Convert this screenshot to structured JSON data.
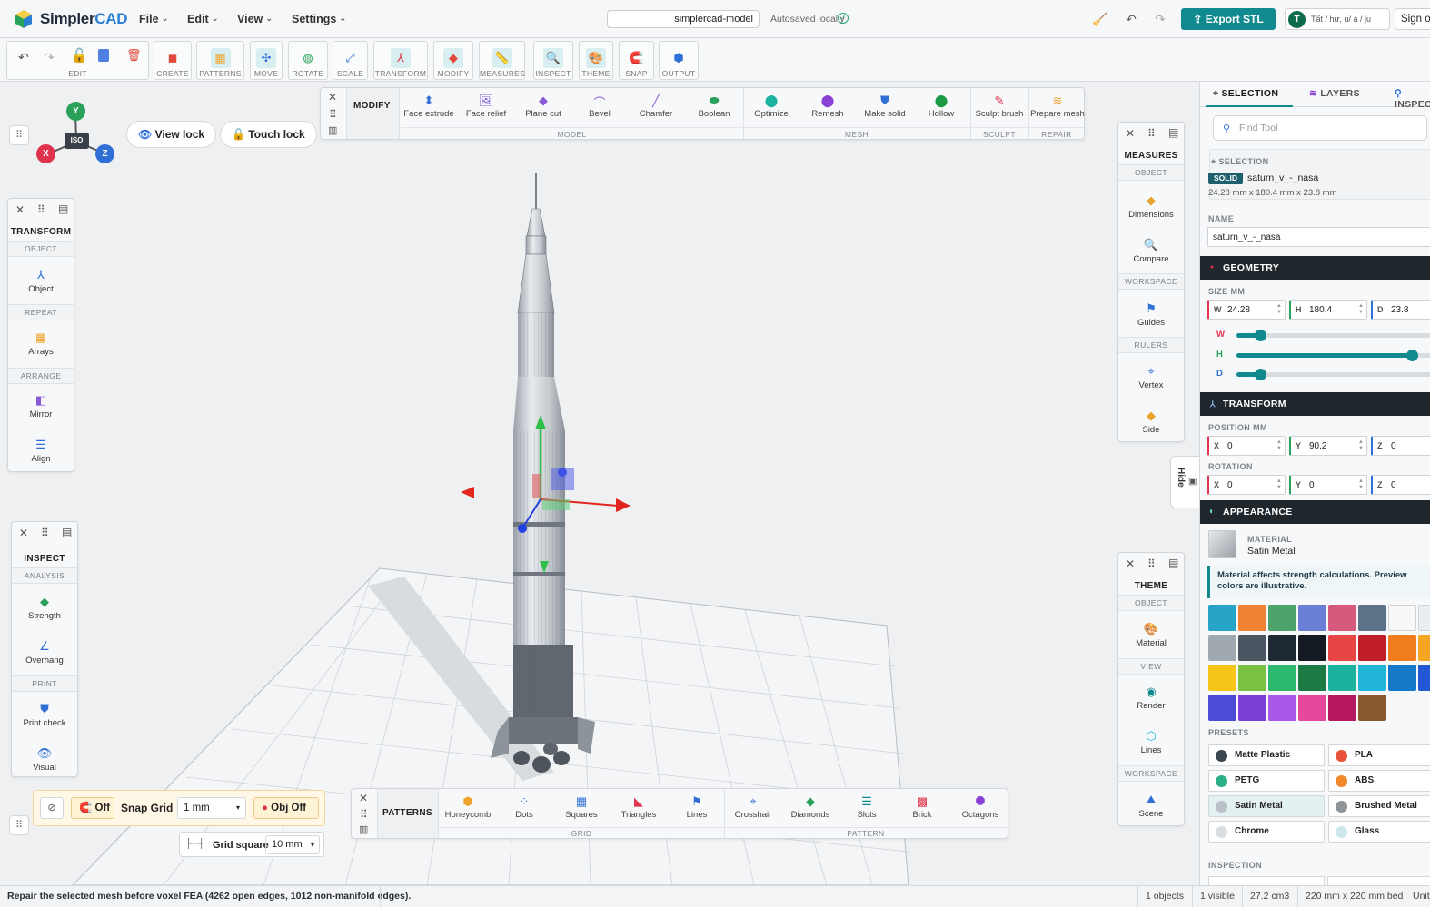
{
  "app": {
    "brand_a": "Simpler",
    "brand_b": "CAD"
  },
  "menu": {
    "file": "File",
    "edit": "Edit",
    "view": "View",
    "settings": "Settings"
  },
  "topbar": {
    "model_name": "simplercad-model",
    "autosave": "Autosaved locally",
    "export": "Export STL",
    "avatar_letter": "T",
    "user_name": "Tất / hư, u/ á / ju",
    "signin": "Sign out"
  },
  "ribbon": [
    {
      "label": "EDIT"
    },
    {
      "label": "CREATE"
    },
    {
      "label": "PATTERNS"
    },
    {
      "label": "MOVE"
    },
    {
      "label": "ROTATE"
    },
    {
      "label": "SCALE"
    },
    {
      "label": "TRANSFORM"
    },
    {
      "label": "MODIFY"
    },
    {
      "label": "MEASURES"
    },
    {
      "label": "INSPECT"
    },
    {
      "label": "THEME"
    },
    {
      "label": "SNAP"
    },
    {
      "label": "OUTPUT"
    }
  ],
  "view_controls": {
    "iso": "ISO",
    "x": "X",
    "y": "Y",
    "z": "Z",
    "view_lock": "View lock",
    "touch_lock": "Touch lock"
  },
  "modify_bar": {
    "title": "MODIFY",
    "tools": [
      "Face extrude",
      "Face relief",
      "Plane cut",
      "Bevel",
      "Chamfer",
      "Boolean",
      "Optimize",
      "Remesh",
      "Make solid",
      "Hollow",
      "Sculpt brush",
      "Prepare mesh"
    ],
    "sections": [
      "MODEL",
      "MESH",
      "SCULPT",
      "REPAIR"
    ]
  },
  "transform_panel": {
    "title": "TRANSFORM",
    "s1": "OBJECT",
    "t1": "Object",
    "s2": "REPEAT",
    "t2": "Arrays",
    "s3": "ARRANGE",
    "t3": "Mirror",
    "t4": "Align"
  },
  "inspect_panel": {
    "title": "INSPECT",
    "s1": "ANALYSIS",
    "t1": "Strength",
    "t2": "Overhang",
    "s2": "PRINT",
    "t3": "Print check",
    "t4": "Visual"
  },
  "measures_panel": {
    "title": "MEASURES",
    "s1": "OBJECT",
    "t1": "Dimensions",
    "t2": "Compare",
    "s2": "WORKSPACE",
    "t3": "Guides",
    "s3": "RULERS",
    "t4": "Vertex",
    "t5": "Side"
  },
  "theme_panel": {
    "title": "THEME",
    "s1": "OBJECT",
    "t1": "Material",
    "s2": "VIEW",
    "t2": "Render",
    "t3": "Lines",
    "s3": "WORKSPACE",
    "t4": "Scene"
  },
  "hide_tab": "Hide",
  "snap_bar": {
    "snap_state": "Off",
    "snap_grid_label": "Snap Grid",
    "snap_grid_value": "1 mm",
    "obj_snap": "Obj Off",
    "grid_square_label": "Grid square",
    "grid_square_value": "10 mm"
  },
  "patterns_bar": {
    "title": "PATTERNS",
    "tools": [
      "Honeycomb",
      "Dots",
      "Squares",
      "Triangles",
      "Lines",
      "Crosshair",
      "Diamonds",
      "Slots",
      "Brick",
      "Octagons"
    ],
    "sections": [
      "GRID",
      "PATTERN"
    ]
  },
  "sidebar": {
    "tabs": [
      "SELECTION",
      "LAYERS",
      "INSPECT"
    ],
    "search_placeholder": "Find Tool",
    "selection_label": "SELECTION",
    "badge": "SOLID",
    "object_name": "saturn_v_-_nasa",
    "dims": "24.28 mm x 180.4 mm x 23.8 mm",
    "name_label": "NAME",
    "name_value": "saturn_v_-_nasa",
    "geometry": "GEOMETRY",
    "size_label": "SIZE MM",
    "w": "24.28",
    "h": "180.4",
    "d": "23.8",
    "slider_w": 0.12,
    "slider_h": 0.9,
    "slider_d": 0.12,
    "transform": "TRANSFORM",
    "position_label": "POSITION MM",
    "px": "0",
    "py": "90.2",
    "pz": "0",
    "rotation_label": "ROTATION",
    "rx": "0",
    "ry": "0",
    "rz": "0",
    "appearance": "APPEARANCE",
    "material_label": "MATERIAL",
    "material_value": "Satin Metal",
    "note": "Material affects strength calculations. Preview colors are illustrative.",
    "swatches": [
      "#27a5c8",
      "#ef8233",
      "#4ea36b",
      "#6c7fd6",
      "#d65a7b",
      "#5c7286",
      "#f8f8f8",
      "#e8eef2",
      "#a0a8b0",
      "#4b5663",
      "#1e2833",
      "#141a22",
      "#e84545",
      "#c01f2a",
      "#f27d1c",
      "#f4a523",
      "#f5c518",
      "#7ac142",
      "#2cb86e",
      "#1c7a45",
      "#1bb3a0",
      "#21b6d8",
      "#1479c9",
      "#2457d6",
      "#4b4bd6",
      "#7e3fd6",
      "#a857e8",
      "#e6489c",
      "#b8195e",
      "#8a5a2e"
    ],
    "presets_label": "PRESETS",
    "presets": [
      {
        "name": "Matte Plastic",
        "color": "#3c4650"
      },
      {
        "name": "PLA",
        "color": "#e8523a"
      },
      {
        "name": "PETG",
        "color": "#2bb08a"
      },
      {
        "name": "ABS",
        "color": "#f08a2c"
      },
      {
        "name": "Satin Metal",
        "color": "#b9c0c6"
      },
      {
        "name": "Brushed Metal",
        "color": "#8d949a"
      },
      {
        "name": "Chrome",
        "color": "#d8dde0"
      },
      {
        "name": "Glass",
        "color": "#cfe8f0"
      }
    ],
    "inspection_label": "INSPECTION"
  },
  "status": {
    "message": "Repair the selected mesh before voxel FEA (4262 open edges, 1012 non-manifold edges).",
    "objects": "1 objects",
    "visible": "1 visible",
    "volume": "27.2 cm3",
    "bed": "220 mm x 220 mm bed",
    "units": "Units"
  },
  "colors": {
    "accent": "#118a8f",
    "dark": "#1f262c",
    "axis_x": "#e0334d",
    "axis_y": "#2aa15a",
    "axis_z": "#2f6fd6"
  }
}
